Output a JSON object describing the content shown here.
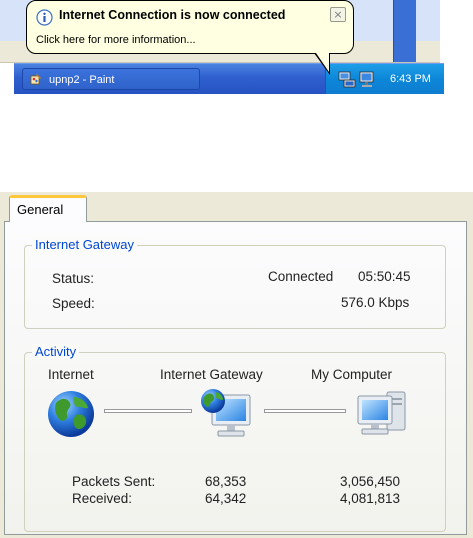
{
  "taskbar": {
    "task_label": "upnp2 - Paint",
    "clock": "6:43 PM"
  },
  "balloon": {
    "title": "Internet Connection is now connected",
    "message": "Click here for more information...",
    "close_glyph": "×"
  },
  "dialog": {
    "tab_label": "General",
    "gateway_group": {
      "title": "Internet Gateway",
      "status_label": "Status:",
      "status_value": "Connected",
      "duration": "05:50:45",
      "speed_label": "Speed:",
      "speed_value": "576.0 Kbps"
    },
    "activity_group": {
      "title": "Activity",
      "nodes": [
        "Internet",
        "Internet Gateway",
        "My Computer"
      ],
      "packets_sent_label": "Packets Sent:",
      "received_label": "Received:",
      "gateway_sent": "68,353",
      "gateway_received": "64,342",
      "computer_sent": "3,056,450",
      "computer_received": "4,081,813"
    }
  },
  "icons": {
    "info": "info-icon",
    "app": "paint-icon",
    "tray_network": "network-connection-icon",
    "globe": "globe-icon",
    "gateway": "gateway-computer-icon",
    "computer": "computer-icon"
  },
  "colors": {
    "taskbar_blue": "#2f5fcf",
    "tray_blue": "#0d87d9",
    "balloon_bg": "#ffffe1",
    "group_title": "#0046d5",
    "tab_accent": "#ffc83c"
  }
}
